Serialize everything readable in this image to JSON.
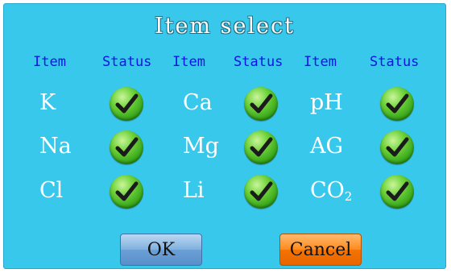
{
  "dialog": {
    "title": "Item select",
    "headers": [
      "Item",
      "Status",
      "Item",
      "Status",
      "Item",
      "Status"
    ],
    "columns": [
      {
        "items": [
          "K",
          "Na",
          "Cl"
        ]
      },
      {
        "items": [
          "Ca",
          "Mg",
          "Li"
        ]
      },
      {
        "items": [
          "pH",
          "AG",
          "CO"
        ]
      }
    ],
    "co2_subscript": "2",
    "status_icon": "green-checkmark-icon",
    "ok_label": "OK",
    "cancel_label": "Cancel"
  },
  "colors": {
    "background": "#38c8ec",
    "header_text": "#1212e6",
    "item_text": "#ffffff",
    "ok_button": "#7fb0de",
    "cancel_button": "#ff8a1e",
    "check_green": "#3aae1e"
  }
}
